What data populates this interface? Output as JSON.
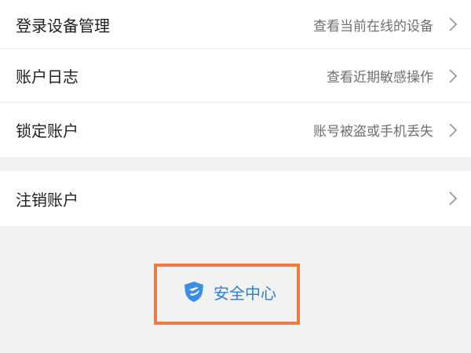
{
  "menu": {
    "items": [
      {
        "label": "登录设备管理",
        "desc": "查看当前在线的设备",
        "icon": "chevron-right-icon"
      },
      {
        "label": "账户日志",
        "desc": "查看近期敏感操作",
        "icon": "chevron-right-icon"
      },
      {
        "label": "锁定账户",
        "desc": "账号被盗或手机丢失",
        "icon": "chevron-right-icon"
      },
      {
        "label": "注销账户",
        "desc": "",
        "icon": "chevron-right-icon"
      }
    ]
  },
  "footer": {
    "security_center": {
      "label": "安全中心",
      "icon": "shield-icon",
      "text_color": "#2f7fd6"
    },
    "highlight_color": "#f07a45"
  }
}
